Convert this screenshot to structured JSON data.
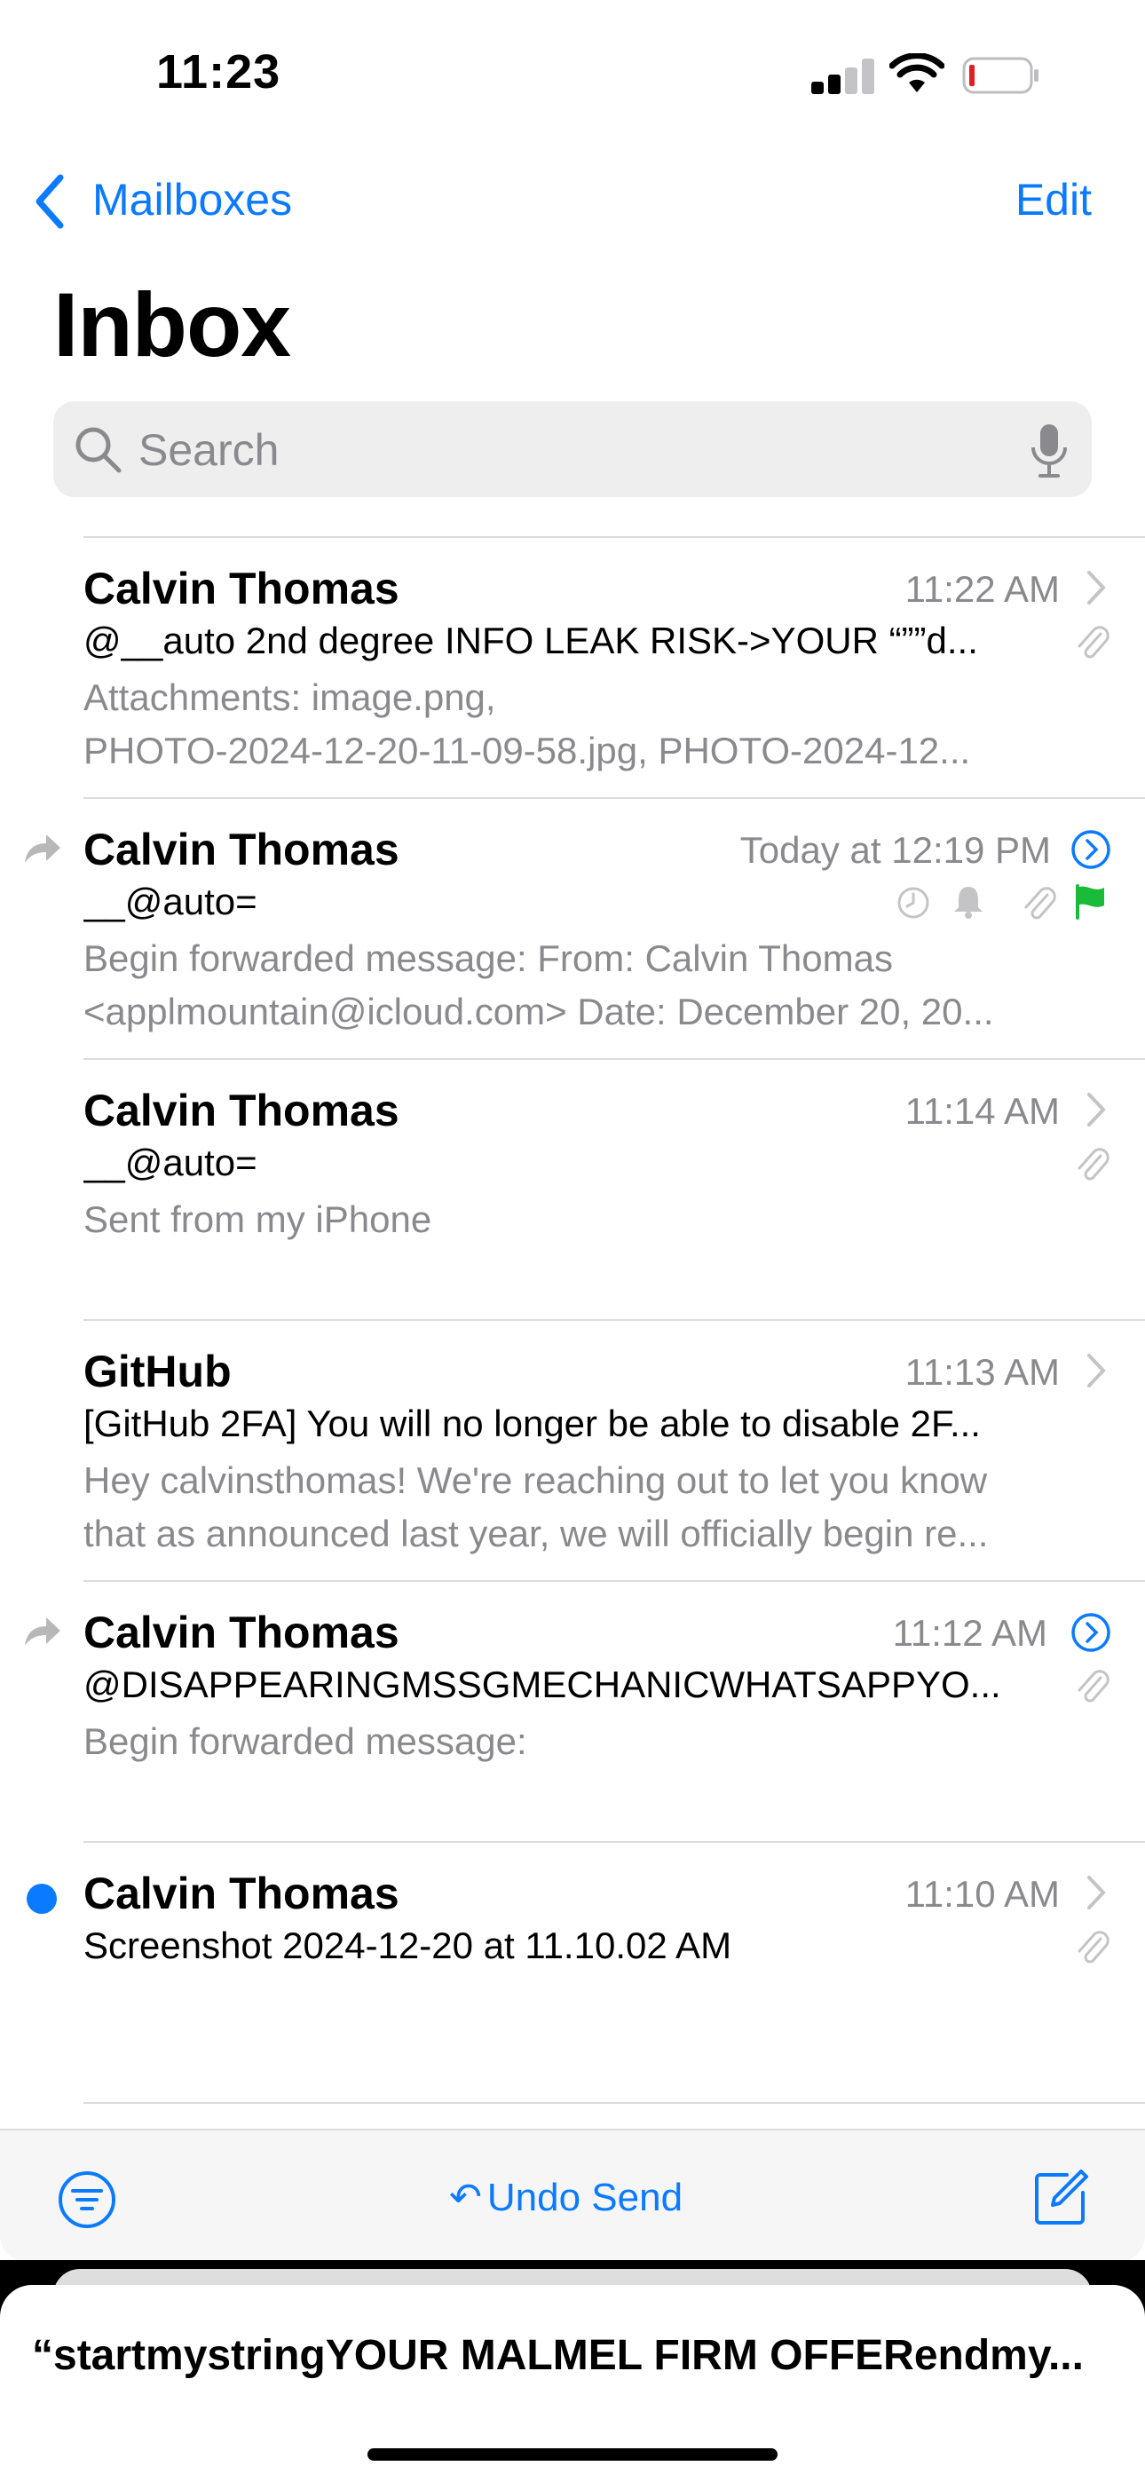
{
  "status_bar": {
    "time": "11:23"
  },
  "nav": {
    "back_label": "Mailboxes",
    "edit_label": "Edit",
    "title": "Inbox"
  },
  "search": {
    "placeholder": "Search"
  },
  "emails": [
    {
      "sender": "Calvin Thomas",
      "time": "11:22 AM",
      "subject": "@__auto 2nd degree INFO LEAK RISK->YOUR “””d...",
      "preview": [
        "Attachments: image.png,",
        "PHOTO-2024-12-20-11-09-58.jpg, PHOTO-2024-12..."
      ],
      "has_attachment": true
    },
    {
      "sender": "Calvin Thomas",
      "time": "Today at 12:19 PM",
      "subject": "__@auto=",
      "preview": [
        "Begin forwarded message: From: Calvin Thomas",
        "<applmountain@icloud.com> Date: December 20, 20..."
      ],
      "forwarded": true,
      "has_attachment": true,
      "flag_color": "#1bbb3a"
    },
    {
      "sender": "Calvin Thomas",
      "time": "11:14 AM",
      "subject": "__@auto=",
      "preview": [
        "Sent from my iPhone"
      ],
      "has_attachment": true
    },
    {
      "sender": "GitHub",
      "time": "11:13 AM",
      "subject": "[GitHub 2FA] You will no longer be able to disable 2F...",
      "preview": [
        "Hey calvinsthomas! We're reaching out to let you know",
        "that as announced last year, we will officially begin re..."
      ]
    },
    {
      "sender": "Calvin Thomas",
      "time": "11:12 AM",
      "subject": "@DISAPPEARINGMSSGMECHANICWHATSAPPYO...",
      "preview": [
        "Begin forwarded message:"
      ],
      "forwarded": true,
      "has_attachment": true
    },
    {
      "sender": "Calvin Thomas",
      "time": "11:10 AM",
      "subject": "Screenshot 2024-12-20 at 11.10.02 AM",
      "preview": [],
      "unread": true,
      "has_attachment": true
    }
  ],
  "toolbar": {
    "undo_label": "Undo Send"
  },
  "draft": {
    "title": "“startmystringYOUR MALMEL FIRM OFFERendmy..."
  },
  "colors": {
    "accent": "#0a7aff",
    "secondary_text": "#8a8a8e",
    "battery_low": "#e02020"
  }
}
